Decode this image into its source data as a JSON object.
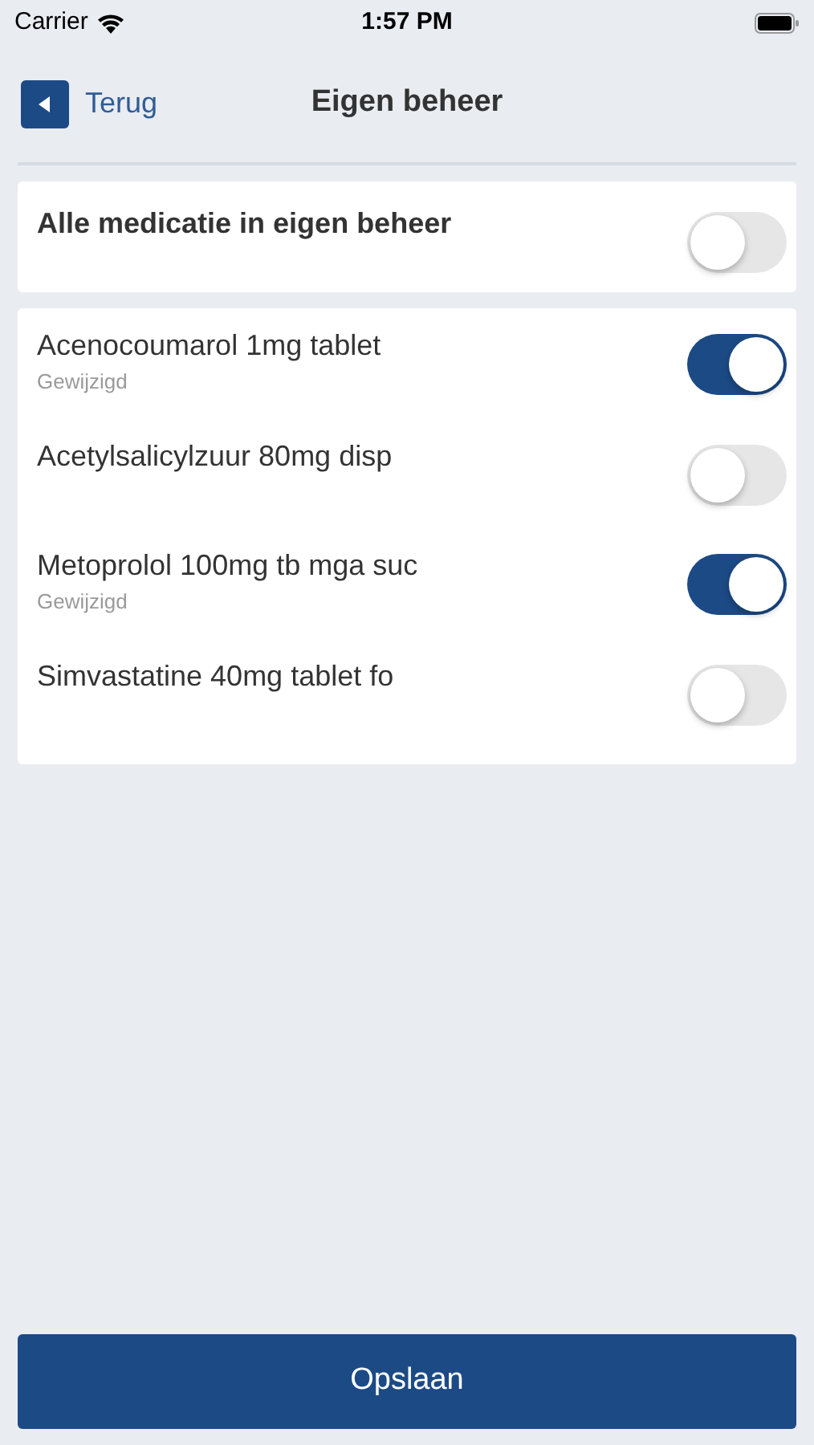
{
  "status_bar": {
    "carrier": "Carrier",
    "time": "1:57 PM"
  },
  "header": {
    "back_label": "Terug",
    "title": "Eigen beheer"
  },
  "master": {
    "label": "Alle medicatie in eigen beheer",
    "on": false
  },
  "medications": [
    {
      "name": "Acenocoumarol 1mg tablet",
      "note": "Gewijzigd",
      "on": true
    },
    {
      "name": "Acetylsalicylzuur 80mg disp",
      "on": false
    },
    {
      "name": "Metoprolol 100mg tb mga suc",
      "note": "Gewijzigd",
      "on": true
    },
    {
      "name": "Simvastatine 40mg tablet fo",
      "on": false
    }
  ],
  "save_button": "Opslaan"
}
